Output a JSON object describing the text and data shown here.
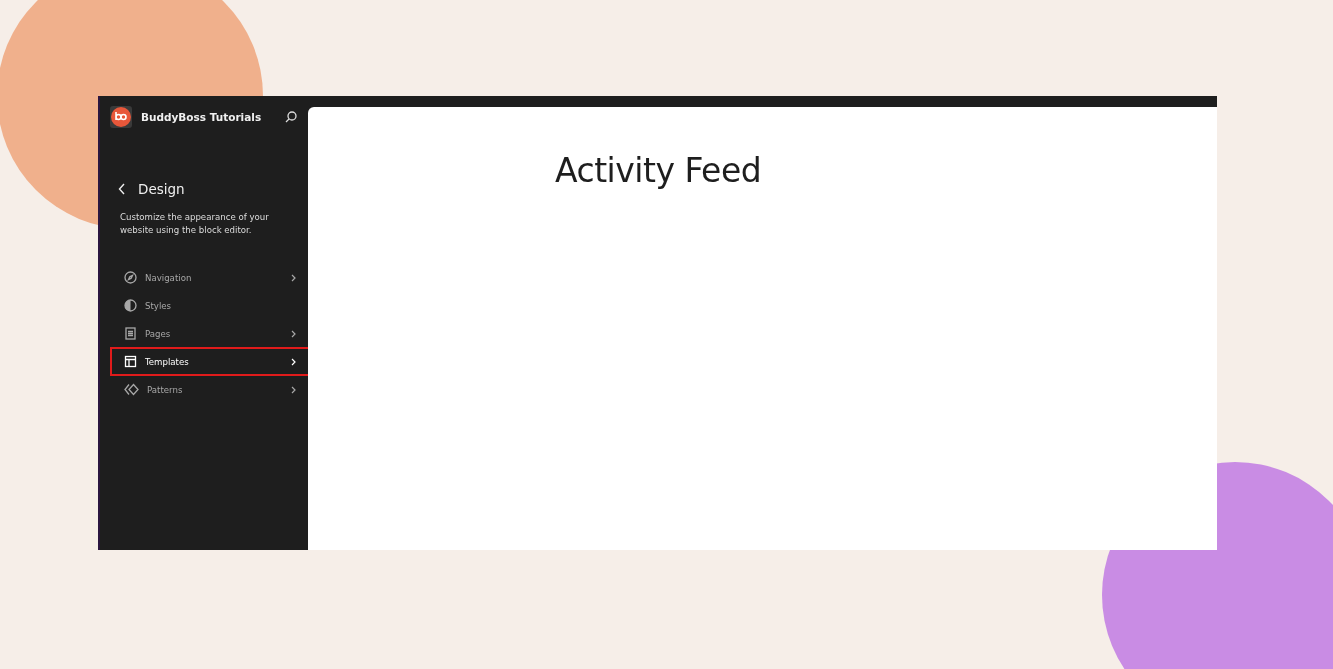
{
  "site": {
    "title": "BuddyBoss Tutorials"
  },
  "panel": {
    "title": "Design",
    "description": "Customize the appearance of your website using the block editor."
  },
  "menu": [
    {
      "kind": "navigation",
      "label": "Navigation",
      "has_submenu": true,
      "selected": false
    },
    {
      "kind": "styles",
      "label": "Styles",
      "has_submenu": false,
      "selected": false
    },
    {
      "kind": "pages",
      "label": "Pages",
      "has_submenu": true,
      "selected": false
    },
    {
      "kind": "templates",
      "label": "Templates",
      "has_submenu": true,
      "selected": true
    },
    {
      "kind": "patterns",
      "label": "Patterns",
      "has_submenu": true,
      "selected": false
    }
  ],
  "canvas": {
    "heading": "Activity Feed"
  }
}
